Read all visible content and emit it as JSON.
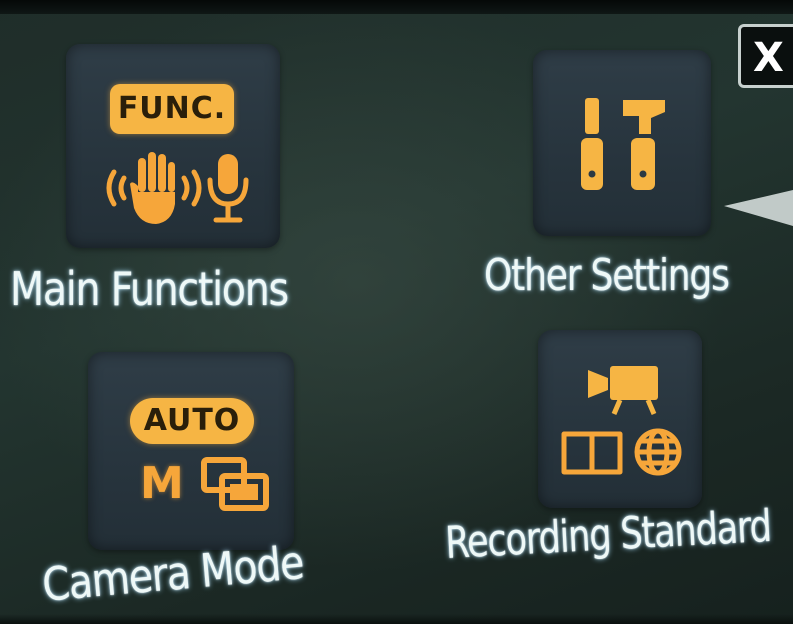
{
  "menu": {
    "tiles": [
      {
        "label": "Main Functions",
        "badge": "FUNC.",
        "icon": "func-gesture-mic-icon"
      },
      {
        "label": "Other Settings",
        "icon": "wrench-hammer-icon"
      },
      {
        "label": "Camera Mode",
        "badge": "AUTO",
        "mode_letter": "M",
        "icon": "auto-manual-scene-icon"
      },
      {
        "label": "Recording Standard",
        "icon": "camcorder-book-globe-icon"
      }
    ]
  },
  "back_button": {
    "label": "X",
    "icon": "close-icon"
  },
  "colors": {
    "icon_orange": "#f6a63a",
    "badge_fill": "#f6b544",
    "label_text": "#eef8f7",
    "tile_bg": "#2b3943",
    "screen_bg": "#1f2d29"
  }
}
